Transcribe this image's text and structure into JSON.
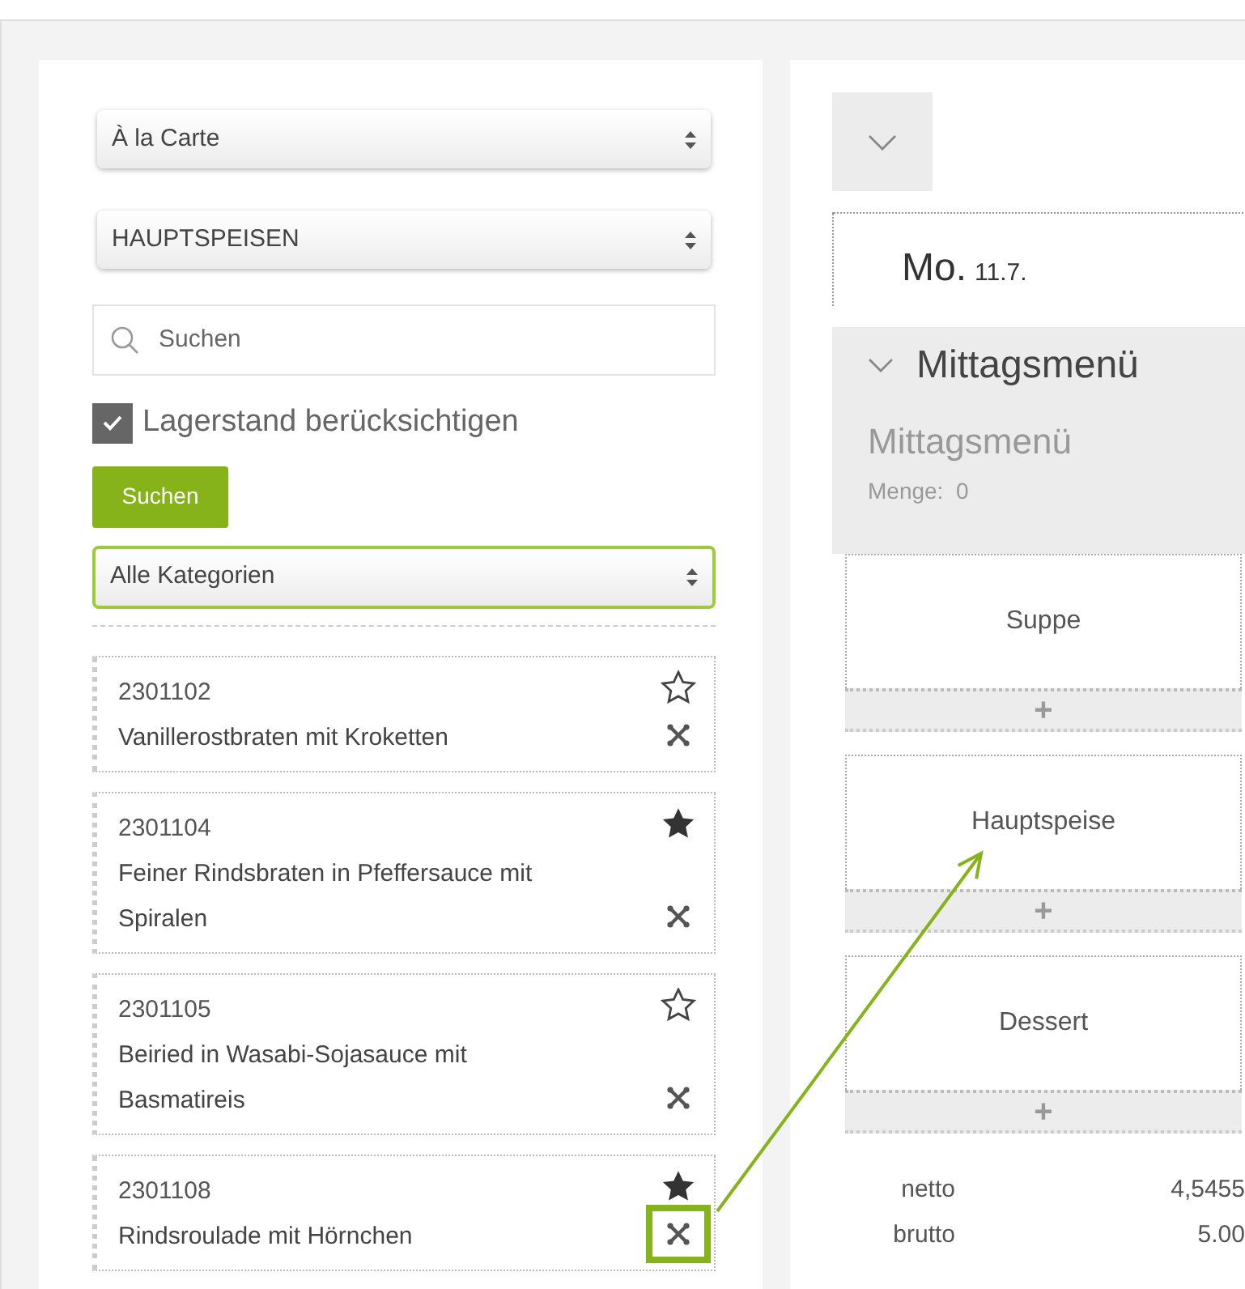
{
  "filters": {
    "menu_select": "À la Carte",
    "section_select": "HAUPTSPEISEN",
    "search": {
      "placeholder": "Suchen"
    },
    "stock_check": {
      "label": "Lagerstand berücksichtigen",
      "checked": true
    },
    "search_button": "Suchen",
    "category_select": "Alle Kategorien"
  },
  "items": [
    {
      "number": "2301102",
      "name": "Vanillerostbraten mit Kroketten",
      "starred": false,
      "highlighted": false
    },
    {
      "number": "2301104",
      "name": "Feiner Rindsbraten in Pfeffersauce mit Spiralen",
      "starred": true,
      "highlighted": false
    },
    {
      "number": "2301105",
      "name": "Beiried in Wasabi-Sojasauce mit Basmatireis",
      "starred": false,
      "highlighted": false
    },
    {
      "number": "2301108",
      "name": "Rindsroulade mit Hörnchen",
      "starred": true,
      "highlighted": true
    }
  ],
  "day": {
    "weekday": "Mo.",
    "date": "11.7."
  },
  "menu": {
    "title": "Mittagsmenü",
    "expanded": true,
    "name": "Mittagsmenü",
    "quantity": "Menge:  0"
  },
  "courses": [
    {
      "label": "Suppe",
      "add": "+",
      "target": false
    },
    {
      "label": "Hauptspeise",
      "add": "+",
      "target": true
    },
    {
      "label": "Dessert",
      "add": "+",
      "target": false
    }
  ],
  "totals": [
    {
      "label": "netto",
      "value": "4,5455"
    },
    {
      "label": "brutto",
      "value": "5.00"
    }
  ]
}
